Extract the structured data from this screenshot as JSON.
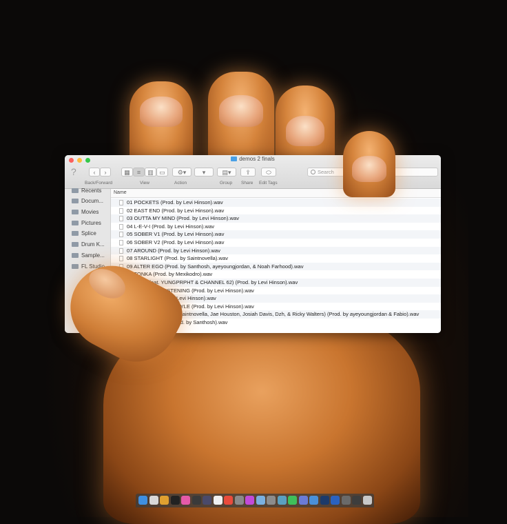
{
  "window": {
    "title": "demos 2 finals"
  },
  "toolbar": {
    "back_forward_label": "Back/Forward",
    "view_label": "View",
    "action_label": "Action",
    "group_label": "Group",
    "share_label": "Share",
    "edit_tags_label": "Edit Tags",
    "search_placeholder": "Search",
    "help_glyph": "?",
    "back_glyph": "‹",
    "forward_glyph": "›"
  },
  "sidebar": {
    "items": [
      {
        "label": "Recents",
        "icon": "clock-icon"
      },
      {
        "label": "Docum...",
        "icon": "folder-icon"
      },
      {
        "label": "Movies",
        "icon": "film-icon"
      },
      {
        "label": "Pictures",
        "icon": "camera-icon"
      },
      {
        "label": "Splice",
        "icon": "folder-icon"
      },
      {
        "label": "Drum K...",
        "icon": "folder-icon"
      },
      {
        "label": "Sample...",
        "icon": "folder-icon"
      },
      {
        "label": "FL Studio",
        "icon": "folder-icon"
      }
    ]
  },
  "list": {
    "column_name": "Name",
    "files": [
      "01 POCKETS (Prod. by Levi Hinson).wav",
      "02 EAST END (Prod. by Levi Hinson).wav",
      "03 OUTTA MY MIND (Prod. by Levi Hinson).wav",
      "04 L-E-V-I (Prod. by Levi Hinson).wav",
      "05 SOBER V1 (Prod. by Levi Hinson).wav",
      "06 SOBER V2 (Prod. by Levi Hinson).wav",
      "07 AROUND (Prod. by Levi Hinson).wav",
      "08 STARLIGHT (Prod. by Saintnovella).wav",
      "09 ALTER EGO (Prod. by Santhosh, ayeyoungjordan, & Noah Farhood).wav",
      "10 TONKA (Prod. by Mexikodro).wav",
      "11 KIKO (feat. YUNGPRPHT & CHANNEL 62) (Prod. by Levi Hinson).wav",
      "12 I WAS NOT LISTENING (Prod. by Levi Hinson).wav",
      "13 YORKE (Prod. by Levi Hinson).wav",
      "ONE SHOT FREESTYLE (Prod. by Levi Hinson).wav",
      "SUPERBOP (feat. Saintnovella, Jae Houston, Josiah Davis, Dzh, & Ricky Walters) (Prod. by ayeyoungjordan & Fabio).wav",
      "ON'T PANIC! (Prod. by Santhosh).wav"
    ]
  },
  "colors": {
    "close": "#fc605c",
    "minimize": "#fdbc40",
    "zoom": "#34c84a",
    "folder_accent": "#4aa0e6"
  },
  "dock": {
    "icons": [
      {
        "name": "finder-icon",
        "color": "#3f8fe0"
      },
      {
        "name": "launchpad-icon",
        "color": "#d8d8d8"
      },
      {
        "name": "pencil-icon",
        "color": "#e0a030"
      },
      {
        "name": "terminal-icon",
        "color": "#222222"
      },
      {
        "name": "photos-icon",
        "color": "#e45aa8"
      },
      {
        "name": "music-app-icon",
        "color": "#3a3a3a"
      },
      {
        "name": "plugin-icon",
        "color": "#4a4a6a"
      },
      {
        "name": "launcher-icon",
        "color": "#f0f0f0"
      },
      {
        "name": "chrome-icon",
        "color": "#e94b3c"
      },
      {
        "name": "app-icon",
        "color": "#8a8a8a"
      },
      {
        "name": "itunes-icon",
        "color": "#c24ad9"
      },
      {
        "name": "compass-icon",
        "color": "#7ab0e0"
      },
      {
        "name": "settings-icon",
        "color": "#8c8c8c"
      },
      {
        "name": "photo-icon",
        "color": "#5aa0c0"
      },
      {
        "name": "messages-icon",
        "color": "#3fbf5a"
      },
      {
        "name": "discord-icon",
        "color": "#6a7bd6"
      },
      {
        "name": "mail-icon",
        "color": "#4a90d9"
      },
      {
        "name": "photoshop-icon",
        "color": "#1c3a6a"
      },
      {
        "name": "bar-icon",
        "color": "#2a62c0"
      },
      {
        "name": "window-icon",
        "color": "#6a6a6a"
      },
      {
        "name": "monitor-icon",
        "color": "#3d3d3d"
      },
      {
        "name": "trash-icon",
        "color": "#c8c8c8"
      }
    ]
  }
}
